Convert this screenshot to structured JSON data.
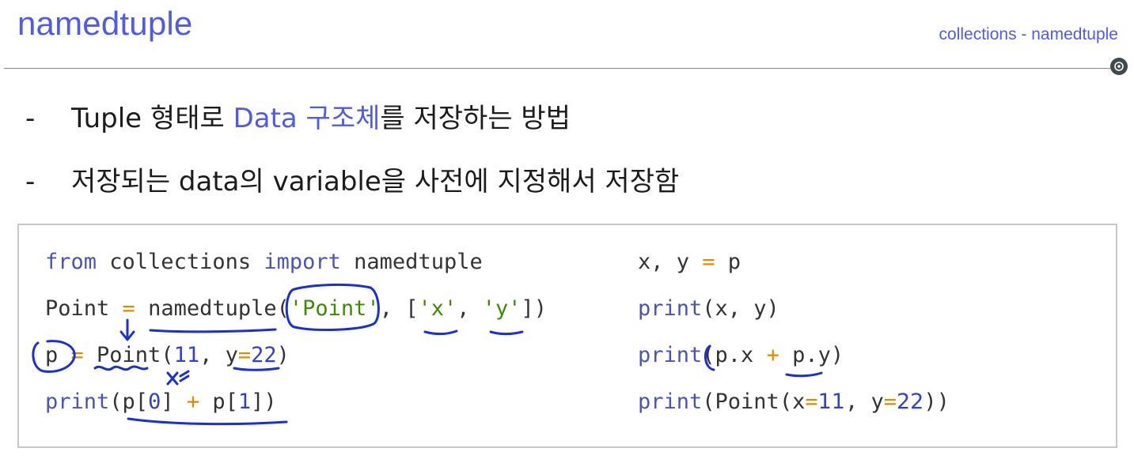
{
  "header": {
    "title": "namedtuple",
    "breadcrumb": "collections - namedtuple"
  },
  "bullets": [
    {
      "dash": "-",
      "before": "Tuple 형태로 ",
      "highlight": "Data 구조체",
      "after": "를 저장하는 방법"
    },
    {
      "dash": "-",
      "text": "저장되는 data의 variable을 사전에 지정해서 저장함"
    }
  ],
  "code_left": {
    "l1": {
      "from": "from",
      "mod": " collections ",
      "import": "import",
      "name": " namedtuple"
    },
    "l2": {
      "a": "Point ",
      "eq": "=",
      "b": " namedtuple(",
      "s1": "'Point'",
      "c": ", [",
      "s2": "'x'",
      "d": ", ",
      "s3": "'y'",
      "e": "])"
    },
    "l3": {
      "a": "p ",
      "eq": "=",
      "b": " Point(",
      "n1": "11",
      "c": ", y",
      "eq2": "=",
      "n2": "22",
      "d": ")"
    },
    "l4": {
      "fn": "print",
      "a": "(p[",
      "n0": "0",
      "b": "] ",
      "plus": "+",
      "c": " p[",
      "n1": "1",
      "d": "])"
    }
  },
  "code_right": {
    "r1": {
      "a": "x, y ",
      "eq": "=",
      "b": " p"
    },
    "r2": {
      "fn": "print",
      "a": "(x, y)"
    },
    "r3": {
      "fn": "print",
      "a": "(p.x ",
      "plus": "+",
      "b": " p.y)"
    },
    "r4": {
      "fn": "print",
      "a": "(Point(x",
      "eq": "=",
      "n1": "11",
      "b": ", y",
      "eq2": "=",
      "n2": "22",
      "c": "))"
    }
  },
  "colors": {
    "accent": "#4f5be8",
    "keyword": "#4a54b8",
    "operator": "#e08a00",
    "string": "#3c8c00",
    "number": "#3340c8",
    "ink": "#1a2fd8"
  },
  "icons": {
    "corner": "settings-circle-icon"
  }
}
